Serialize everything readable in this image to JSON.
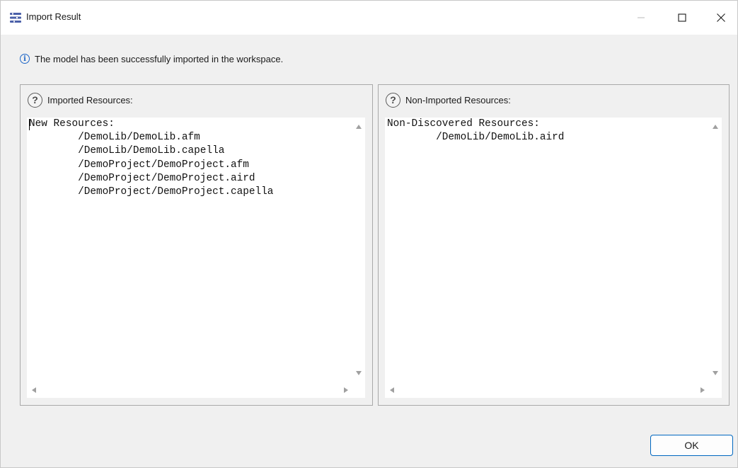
{
  "window": {
    "title": "Import Result",
    "controls": [
      "minimize-icon",
      "maximize-icon",
      "close-icon"
    ]
  },
  "info": {
    "icon": "info-icon",
    "message": "The model has been successfully imported in the workspace."
  },
  "imported": {
    "icon": "help-icon",
    "title": "Imported Resources:",
    "text": "New Resources:\n\t/DemoLib/DemoLib.afm\n\t/DemoLib/DemoLib.capella\n\t/DemoProject/DemoProject.afm\n\t/DemoProject/DemoProject.aird\n\t/DemoProject/DemoProject.capella"
  },
  "non_imported": {
    "icon": "help-icon",
    "title": "Non-Imported Resources:",
    "text": "Non-Discovered Resources:\n\t/DemoLib/DemoLib.aird"
  },
  "buttons": {
    "ok_label": "OK"
  },
  "colors": {
    "accent": "#0067c0",
    "info": "#1e66c7",
    "dialog_bg": "#f0f0f0"
  }
}
